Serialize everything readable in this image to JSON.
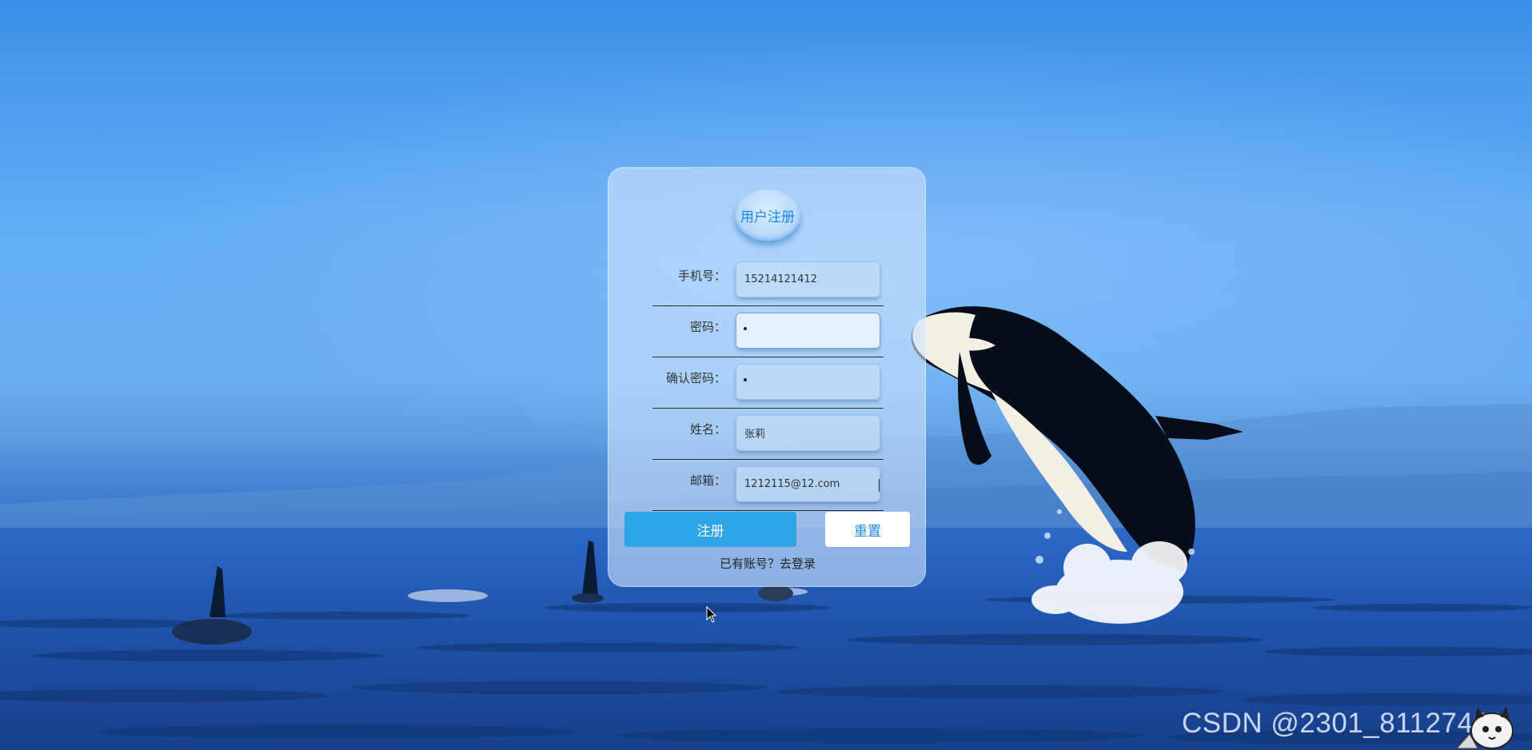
{
  "form": {
    "title": "用户注册",
    "fields": [
      {
        "label": "手机号：",
        "value": "15214121412"
      },
      {
        "label": "密码：",
        "value": ""
      },
      {
        "label": "确认密码：",
        "value": ""
      },
      {
        "label": "姓名：",
        "value": "张莉"
      },
      {
        "label": "邮箱：",
        "value": "1212115@12.com"
      }
    ],
    "register_label": "注册",
    "reset_label": "重置",
    "login_link": "已有账号？去登录"
  },
  "watermark": "CSDN @2301_81127491",
  "colors": {
    "primary": "#2ea3e8",
    "title": "#1e88e5",
    "card": "#cde4fc"
  }
}
